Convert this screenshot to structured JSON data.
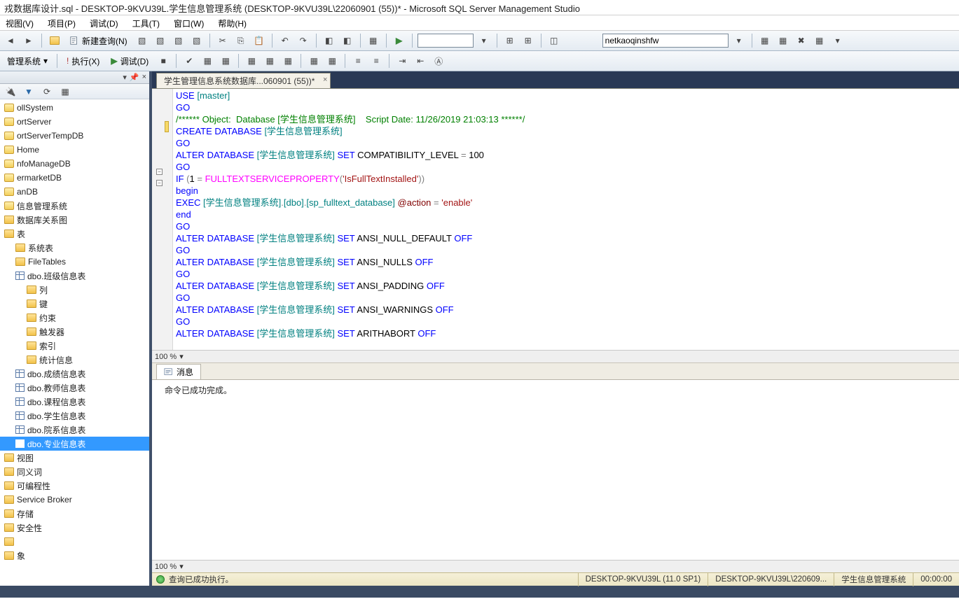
{
  "title": "戎数据库设计.sql - DESKTOP-9KVU39L.学生信息管理系统 (DESKTOP-9KVU39L\\22060901 (55))* - Microsoft SQL Server Management Studio",
  "menu": {
    "view": "视图(V)",
    "project": "项目(P)",
    "debug": "调试(D)",
    "tools": "工具(T)",
    "window": "窗口(W)",
    "help": "帮助(H)"
  },
  "toolbar1": {
    "new_query": "新建查询(N)",
    "combo_value": "netkaoqinshfw"
  },
  "toolbar2": {
    "left_label": "管理系统",
    "execute": "执行(X)",
    "debug": "调试(D)"
  },
  "left_panel": {
    "pin": "▾",
    "close": "×"
  },
  "tree": {
    "items": [
      {
        "depth": 0,
        "icon": "db",
        "label": "ollSystem"
      },
      {
        "depth": 0,
        "icon": "db",
        "label": "ortServer"
      },
      {
        "depth": 0,
        "icon": "db",
        "label": "ortServerTempDB"
      },
      {
        "depth": 0,
        "icon": "db",
        "label": "Home"
      },
      {
        "depth": 0,
        "icon": "db",
        "label": "nfoManageDB"
      },
      {
        "depth": 0,
        "icon": "db",
        "label": "ermarketDB"
      },
      {
        "depth": 0,
        "icon": "db",
        "label": "anDB"
      },
      {
        "depth": 0,
        "icon": "db",
        "label": "信息管理系统"
      },
      {
        "depth": 0,
        "icon": "folder",
        "label": "数据库关系图"
      },
      {
        "depth": 0,
        "icon": "folder",
        "label": "表"
      },
      {
        "depth": 1,
        "icon": "folder",
        "label": "系统表"
      },
      {
        "depth": 1,
        "icon": "folder",
        "label": "FileTables"
      },
      {
        "depth": 1,
        "icon": "table",
        "label": "dbo.班级信息表"
      },
      {
        "depth": 2,
        "icon": "folder",
        "label": "列"
      },
      {
        "depth": 2,
        "icon": "folder",
        "label": "键"
      },
      {
        "depth": 2,
        "icon": "folder",
        "label": "约束"
      },
      {
        "depth": 2,
        "icon": "folder",
        "label": "触发器"
      },
      {
        "depth": 2,
        "icon": "folder",
        "label": "索引"
      },
      {
        "depth": 2,
        "icon": "folder",
        "label": "统计信息"
      },
      {
        "depth": 1,
        "icon": "table",
        "label": "dbo.成绩信息表"
      },
      {
        "depth": 1,
        "icon": "table",
        "label": "dbo.教师信息表"
      },
      {
        "depth": 1,
        "icon": "table",
        "label": "dbo.课程信息表"
      },
      {
        "depth": 1,
        "icon": "table",
        "label": "dbo.学生信息表"
      },
      {
        "depth": 1,
        "icon": "table",
        "label": "dbo.院系信息表"
      },
      {
        "depth": 1,
        "icon": "table",
        "label": "dbo.专业信息表",
        "selected": true
      },
      {
        "depth": 0,
        "icon": "folder",
        "label": "视图"
      },
      {
        "depth": 0,
        "icon": "folder",
        "label": "同义词"
      },
      {
        "depth": 0,
        "icon": "folder",
        "label": "可编程性"
      },
      {
        "depth": 0,
        "icon": "folder",
        "label": "Service Broker"
      },
      {
        "depth": 0,
        "icon": "folder",
        "label": "存储"
      },
      {
        "depth": 0,
        "icon": "folder",
        "label": "安全性"
      },
      {
        "depth": 0,
        "icon": "folder",
        "label": ""
      },
      {
        "depth": 0,
        "icon": "folder",
        "label": "象"
      }
    ]
  },
  "tab": {
    "label": "学生管理信息系统数据库...060901 (55))*"
  },
  "zoom": {
    "value": "100 %"
  },
  "messages": {
    "tab": "消息",
    "body": "命令已成功完成。"
  },
  "status": {
    "ok": "查询已成功执行。",
    "server": "DESKTOP-9KVU39L (11.0 SP1)",
    "user": "DESKTOP-9KVU39L\\220609...",
    "db": "学生信息管理系统",
    "time": "00:00:00"
  },
  "sql": {
    "l1a": "USE ",
    "l1b": "[master]",
    "go": "GO",
    "cmt": "/****** Object:  Database [学生信息管理系统]    Script Date: 11/26/2019 21:03:13 ******/",
    "l3a": "CREATE ",
    "l3b": "DATABASE ",
    "l3c": "[学生信息管理系统]",
    "l5a": "ALTER ",
    "l5b": "DATABASE ",
    "l5c": "[学生信息管理系统]",
    "l5d": " SET ",
    "l5e": "COMPATIBILITY_LEVEL ",
    "l5f": "= ",
    "l5g": "100",
    "l7a": "IF ",
    "l7b": "(",
    "l7c": "1 ",
    "l7d": "= ",
    "l7e": "FULLTEXTSERVICEPROPERTY",
    "l7f": "(",
    "l7g": "'IsFullTextInstalled'",
    "l7h": "))",
    "l8": "begin",
    "l9a": "EXEC ",
    "l9b": "[学生信息管理系统]",
    "l9c": ".",
    "l9d": "[dbo]",
    "l9e": ".",
    "l9f": "[sp_fulltext_database]",
    "l9g": " @action ",
    "l9h": "= ",
    "l9i": "'enable'",
    "l10": "end",
    "l12a": "ALTER ",
    "l12b": "DATABASE ",
    "l12c": "[学生信息管理系统]",
    "l12d": " SET ",
    "l12e": "ANSI_NULL_DEFAULT ",
    "l12f": "OFF",
    "l14e": "ANSI_NULLS ",
    "l16e": "ANSI_PADDING ",
    "l18e": "ANSI_WARNINGS ",
    "l20e": "ARITHABORT "
  }
}
